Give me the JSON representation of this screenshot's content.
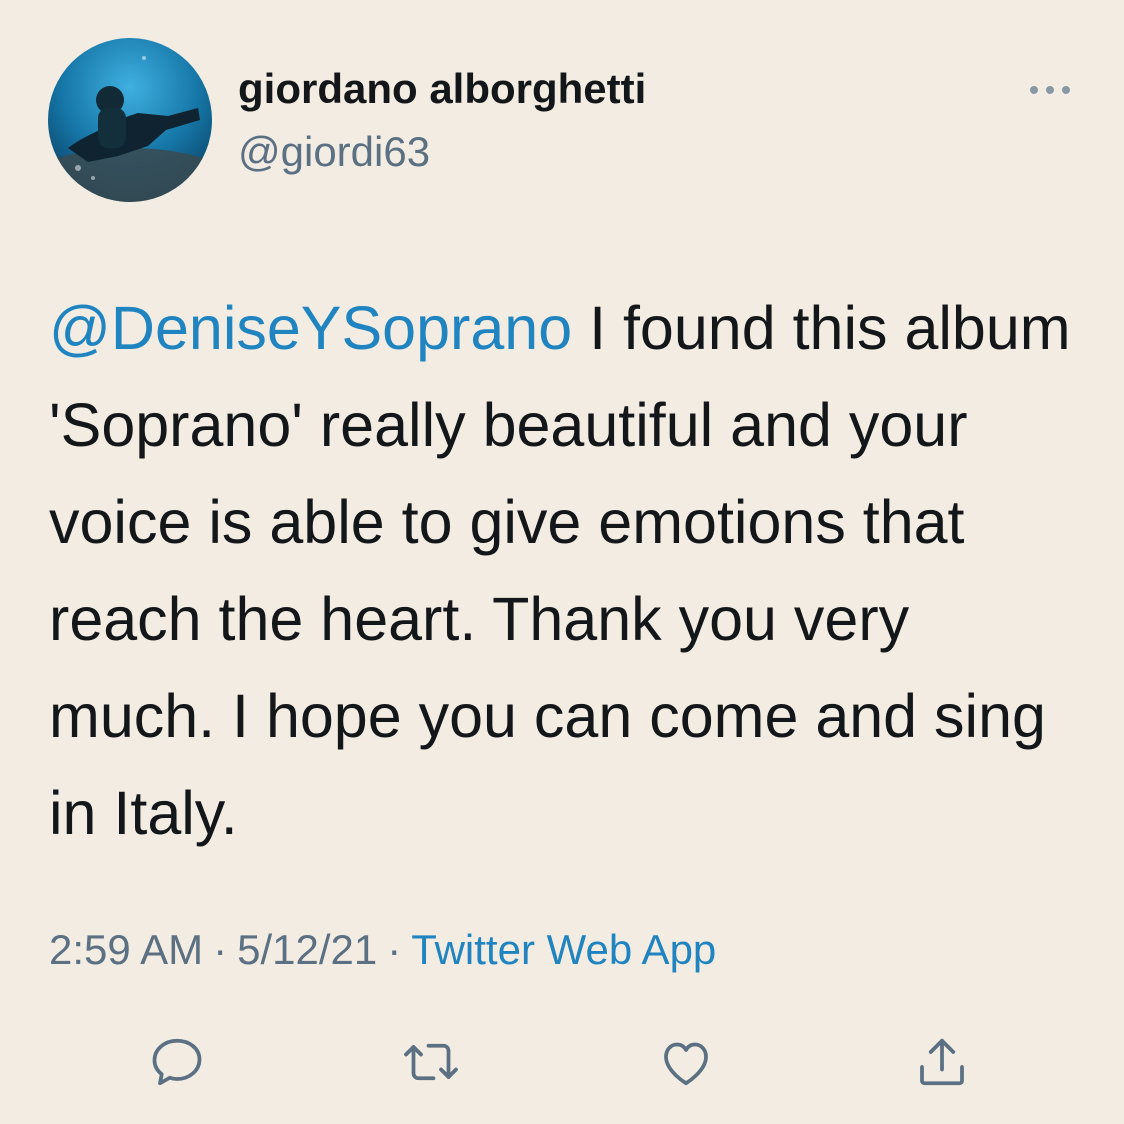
{
  "tweet": {
    "author": {
      "display_name": "giordano alborghetti",
      "handle": "@giordi63",
      "avatar_icon": "scuba-diver-avatar"
    },
    "text": {
      "mention": "@DeniseYSoprano",
      "body": " I found this album 'Soprano' really beautiful and your voice is able to give emotions that reach the heart. Thank you very much. I hope you can come and sing in Italy."
    },
    "meta": {
      "time": "2:59 AM",
      "separator": "·",
      "date": "5/12/21",
      "source": "Twitter Web App"
    },
    "actions": [
      {
        "name": "reply",
        "icon": "reply-icon"
      },
      {
        "name": "retweet",
        "icon": "retweet-icon"
      },
      {
        "name": "like",
        "icon": "heart-icon"
      },
      {
        "name": "share",
        "icon": "share-icon"
      }
    ],
    "more_icon": "more-horizontal-icon"
  },
  "colors": {
    "background": "#f3ece2",
    "text": "#14171a",
    "secondary": "#5b7083",
    "link": "#1f84c0"
  }
}
